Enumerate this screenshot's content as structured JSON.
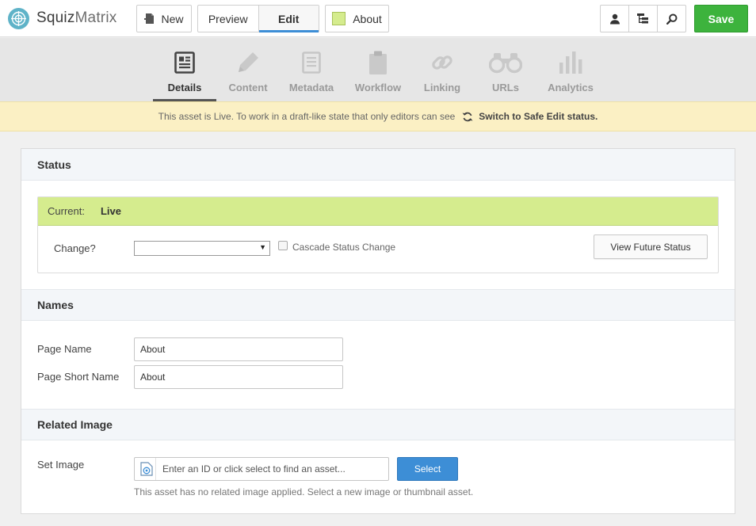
{
  "app": {
    "name_bold": "Squiz",
    "name_thin": "Matrix"
  },
  "toolbar": {
    "new_label": "New",
    "preview_label": "Preview",
    "edit_label": "Edit",
    "asset_label": "About",
    "save_label": "Save"
  },
  "tabs": [
    {
      "label": "Details",
      "icon": "details-icon"
    },
    {
      "label": "Content",
      "icon": "pencil-icon"
    },
    {
      "label": "Metadata",
      "icon": "document-icon"
    },
    {
      "label": "Workflow",
      "icon": "clipboard-icon"
    },
    {
      "label": "Linking",
      "icon": "link-icon"
    },
    {
      "label": "URLs",
      "icon": "binoculars-icon"
    },
    {
      "label": "Analytics",
      "icon": "bar-chart-icon"
    }
  ],
  "notice": {
    "text": "This asset is Live. To work in a draft-like state that only editors can see",
    "link": "Switch to Safe Edit status."
  },
  "status_section": {
    "title": "Status",
    "current_label": "Current:",
    "current_value": "Live",
    "change_label": "Change?",
    "change_selected": "",
    "cascade_label": "Cascade Status Change",
    "future_button": "View Future Status"
  },
  "names_section": {
    "title": "Names",
    "page_name_label": "Page Name",
    "page_name_value": "About",
    "short_name_label": "Page Short Name",
    "short_name_value": "About"
  },
  "image_section": {
    "title": "Related Image",
    "set_image_label": "Set Image",
    "placeholder": "Enter an ID or click select to find an asset...",
    "select_button": "Select",
    "help": "This asset has no related image applied. Select a new image or thumbnail asset."
  },
  "colors": {
    "accent_blue": "#3d8ed6",
    "save_green": "#3db33d",
    "live_green": "#d5ec8e",
    "notice_yellow": "#fbf0c4"
  }
}
